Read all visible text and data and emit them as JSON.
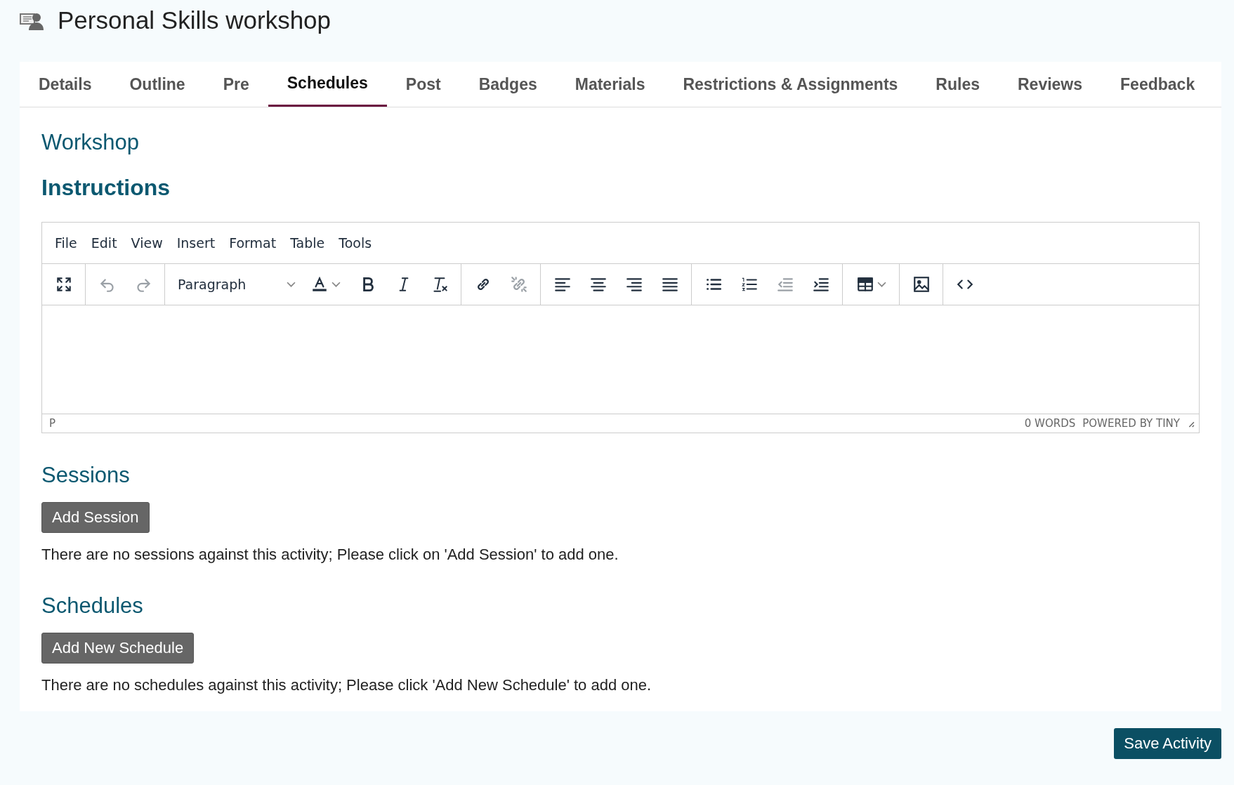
{
  "page": {
    "title": "Personal Skills workshop"
  },
  "tabs": [
    {
      "label": "Details",
      "selected": false
    },
    {
      "label": "Outline",
      "selected": false
    },
    {
      "label": "Pre",
      "selected": false
    },
    {
      "label": "Schedules",
      "selected": true
    },
    {
      "label": "Post",
      "selected": false
    },
    {
      "label": "Badges",
      "selected": false
    },
    {
      "label": "Materials",
      "selected": false
    },
    {
      "label": "Restrictions & Assignments",
      "selected": false
    },
    {
      "label": "Rules",
      "selected": false
    },
    {
      "label": "Reviews",
      "selected": false
    },
    {
      "label": "Feedback",
      "selected": false
    }
  ],
  "section_title": "Workshop",
  "instructions": {
    "heading": "Instructions",
    "editor": {
      "menu": [
        "File",
        "Edit",
        "View",
        "Insert",
        "Format",
        "Table",
        "Tools"
      ],
      "toolbar_groups": [
        [
          {
            "kind": "fullscreen",
            "disabled": false
          }
        ],
        [
          {
            "kind": "undo",
            "disabled": true
          },
          {
            "kind": "redo",
            "disabled": true
          }
        ],
        [
          {
            "kind": "blocks",
            "label": "Paragraph",
            "disabled": false
          },
          {
            "kind": "textcolor",
            "disabled": false
          },
          {
            "kind": "bold",
            "disabled": false
          },
          {
            "kind": "italic",
            "disabled": false
          },
          {
            "kind": "clearformat",
            "disabled": false
          }
        ],
        [
          {
            "kind": "link",
            "disabled": false
          },
          {
            "kind": "unlink",
            "disabled": true
          }
        ],
        [
          {
            "kind": "alignleft",
            "disabled": false
          },
          {
            "kind": "aligncenter",
            "disabled": false
          },
          {
            "kind": "alignright",
            "disabled": false
          },
          {
            "kind": "justify",
            "disabled": false
          }
        ],
        [
          {
            "kind": "bullist",
            "disabled": false
          },
          {
            "kind": "numlist",
            "disabled": false
          },
          {
            "kind": "outdent",
            "disabled": true
          },
          {
            "kind": "indent",
            "disabled": false
          }
        ],
        [
          {
            "kind": "table",
            "disabled": false
          }
        ],
        [
          {
            "kind": "image",
            "disabled": false
          }
        ],
        [
          {
            "kind": "code",
            "disabled": false
          }
        ]
      ],
      "status_path": "P",
      "word_count": "0 WORDS",
      "branding": "POWERED BY TINY"
    }
  },
  "sessions": {
    "heading": "Sessions",
    "button": "Add Session",
    "message": "There are no sessions against this activity; Please click on 'Add Session' to add one."
  },
  "schedules": {
    "heading": "Schedules",
    "button": "Add New Schedule",
    "message": "There are no schedules against this activity; Please click 'Add New Schedule' to add one."
  },
  "save_button": "Save Activity"
}
